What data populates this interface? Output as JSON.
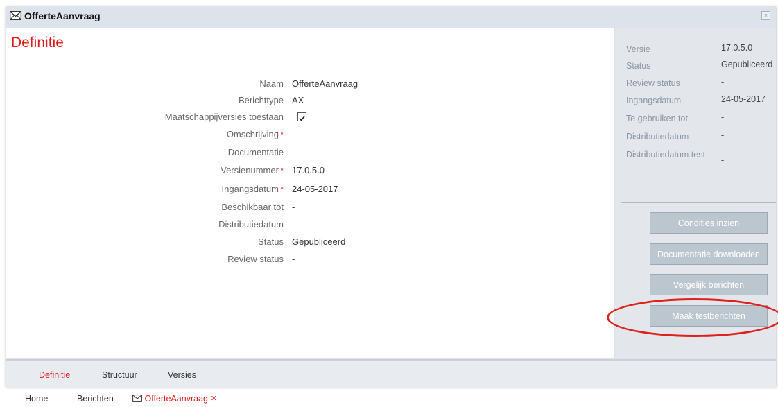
{
  "window": {
    "title": "OfferteAanvraag",
    "icon": "mail-icon",
    "close_icon": "close-icon"
  },
  "main": {
    "title": "Definitie",
    "fields": [
      {
        "label": "Naam",
        "value": "OfferteAanvraag"
      },
      {
        "label": "Berichttype",
        "value": "AX"
      },
      {
        "label": "Maatschappijversies toestaan",
        "value": "",
        "checked": true
      },
      {
        "label": "Omschrijving",
        "value": "",
        "required": true
      },
      {
        "label": "Documentatie",
        "value": "-"
      },
      {
        "label": "Versienummer",
        "value": "17.0.5.0",
        "required": true
      },
      {
        "label": "Ingangsdatum",
        "value": "24-05-2017",
        "required": true
      },
      {
        "label": "Beschikbaar tot",
        "value": "-"
      },
      {
        "label": "Distributiedatum",
        "value": "-"
      },
      {
        "label": "Status",
        "value": "Gepubliceerd"
      },
      {
        "label": "Review status",
        "value": "-"
      }
    ],
    "required_marker": "*"
  },
  "sidebar": {
    "meta": [
      {
        "label": "Versie",
        "value": "17.0.5.0"
      },
      {
        "label": "Status",
        "value": "Gepubliceerd"
      },
      {
        "label": "Review status",
        "value": "-"
      },
      {
        "label": "Ingangsdatum",
        "value": "24-05-2017"
      },
      {
        "label": "Te gebruiken tot",
        "value": "-"
      },
      {
        "label": "Distributiedatum",
        "value": "-"
      },
      {
        "label": "Distributiedatum test",
        "value": "-"
      }
    ],
    "buttons": [
      {
        "label": "Condities inzien"
      },
      {
        "label": "Documentatie downloaden"
      },
      {
        "label": "Vergelijk berichten"
      },
      {
        "label": "Maak testberichten"
      }
    ]
  },
  "tabs": [
    {
      "label": "Definitie",
      "active": true
    },
    {
      "label": "Structuur",
      "active": false
    },
    {
      "label": "Versies",
      "active": false
    }
  ],
  "breadcrumb": {
    "items": [
      "Home",
      "Berichten",
      "OfferteAanvraag"
    ],
    "close": "×"
  },
  "colors": {
    "accent": "#e11b1b",
    "panel": "#e3e7ec",
    "button": "#bcc6cf"
  }
}
